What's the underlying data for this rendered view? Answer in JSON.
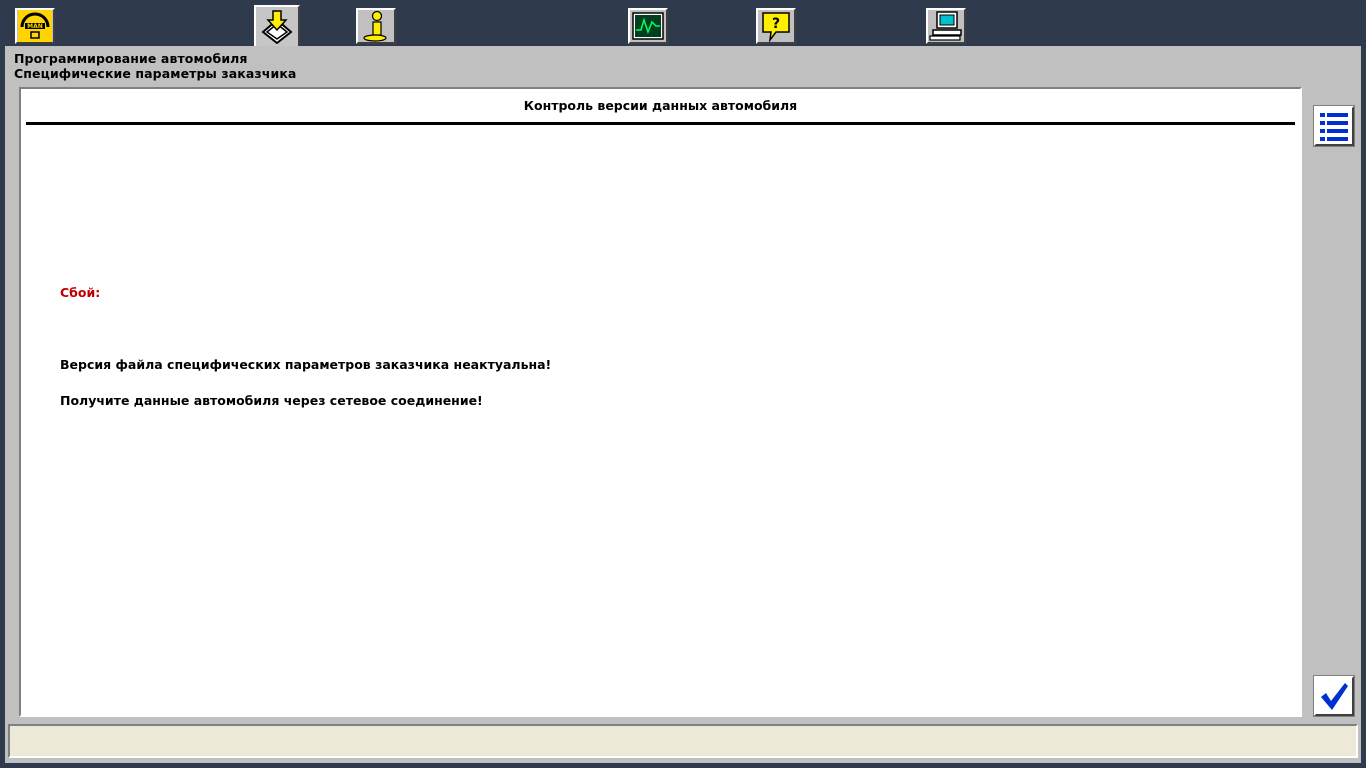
{
  "toolbar": {
    "buttons": [
      {
        "name": "man-logo-button",
        "icon": "man-logo-icon",
        "active": false
      },
      {
        "name": "programming-button",
        "icon": "download-arrow-icon",
        "active": true
      },
      {
        "name": "info-button",
        "icon": "info-person-icon",
        "active": false
      },
      {
        "name": "measurement-button",
        "icon": "oscilloscope-icon",
        "active": false
      },
      {
        "name": "help-button",
        "icon": "question-bubble-icon",
        "active": false
      },
      {
        "name": "computer-button",
        "icon": "computer-icon",
        "active": false
      }
    ]
  },
  "header": {
    "line1": "Программирование автомобиля",
    "line2": "Специфические параметры заказчика"
  },
  "content": {
    "title": "Контроль версии данных автомобиля",
    "error_label": "Сбой:",
    "message1": "Версия файла специфических параметров заказчика неактуальна!",
    "message2": "Получите данные автомобиля через сетевое соединение!"
  },
  "side": {
    "list_icon": "list-icon",
    "confirm_icon": "checkmark-icon"
  },
  "status": {
    "text": ""
  },
  "colors": {
    "background": "#2f3a4c",
    "panel": "#c0c0c0",
    "error": "#c00000",
    "status_bar": "#ece9d8"
  }
}
